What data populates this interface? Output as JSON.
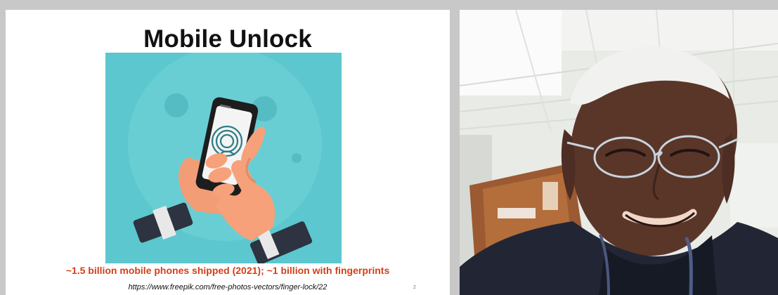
{
  "slide": {
    "title": "Mobile Unlock",
    "caption": "~1.5 billion mobile phones shipped (2021); ~1 billion with fingerprints",
    "source_url": "https://www.freepik.com/free-photos-vectors/finger-lock/22",
    "slide_number": "2",
    "illustration": {
      "background_color": "#5cc7ce",
      "skin_color": "#f6a17a",
      "phone_color": "#1d1d1d",
      "fingerprint_color": "#2f7d88",
      "cuff_color": "#2d3340"
    }
  },
  "video": {
    "wall_color": "#e8ebe6",
    "shirt_color": "#222634"
  }
}
